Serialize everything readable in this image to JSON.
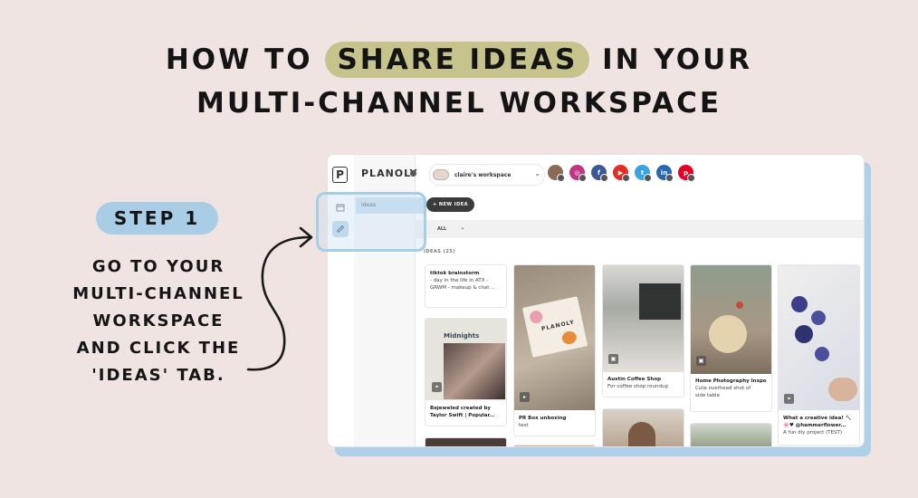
{
  "heading": {
    "line1_pre": "HOW TO",
    "line1_highlight": "SHARE IDEAS",
    "line1_post": "IN YOUR",
    "line2": "MULTI-CHANNEL WORKSPACE"
  },
  "step": {
    "label": "STEP 1",
    "lines": [
      "GO TO YOUR",
      "MULTI-CHANNEL",
      "WORKSPACE",
      "AND CLICK THE",
      "'IDEAS' TAB."
    ]
  },
  "app": {
    "brand": "PLANOLY",
    "logo_letter": "P",
    "sidebar_item": "Ideas",
    "workspace_name": "claire's workspace",
    "new_idea_label": "+ NEW IDEA",
    "filter_label": "ALL",
    "ideas_count": "IDEAS (25)",
    "channels": [
      {
        "icon": "instagram-icon",
        "letter": "◎",
        "color": "#c13584"
      },
      {
        "icon": "facebook-icon",
        "letter": "f",
        "color": "#3b5998"
      },
      {
        "icon": "youtube-icon",
        "letter": "▶",
        "color": "#e52d27"
      },
      {
        "icon": "twitter-icon",
        "letter": "t",
        "color": "#3aa3e3"
      },
      {
        "icon": "linkedin-icon",
        "letter": "in",
        "color": "#2867b2"
      },
      {
        "icon": "pinterest-icon",
        "letter": "p",
        "color": "#e60023"
      }
    ],
    "cards": {
      "tiktok": {
        "title": "tiktok brainstorm",
        "line1": "- day in the life in ATX -",
        "line2": "GRWM - makeup & chat ..."
      },
      "midnights": {
        "title": "Bejeweled created by",
        "line2": "Taylor Swift | Popular...",
        "image_text": "Midnights"
      },
      "prbox": {
        "title": "PR Box unboxing",
        "line2": "test",
        "image_text": "PLANOLY"
      },
      "austin": {
        "title": "Austin Coffee Shop",
        "line2": "For coffee shop roundup"
      },
      "home": {
        "title": "Home Photography Inspo",
        "line2": "Cute overhead shot of",
        "line3": "side table"
      },
      "creative": {
        "title": "What a creative idea! 🔨",
        "line2": "🌸♥ @hammerflower...",
        "line3": "A fun diy project (TEST)"
      }
    }
  }
}
